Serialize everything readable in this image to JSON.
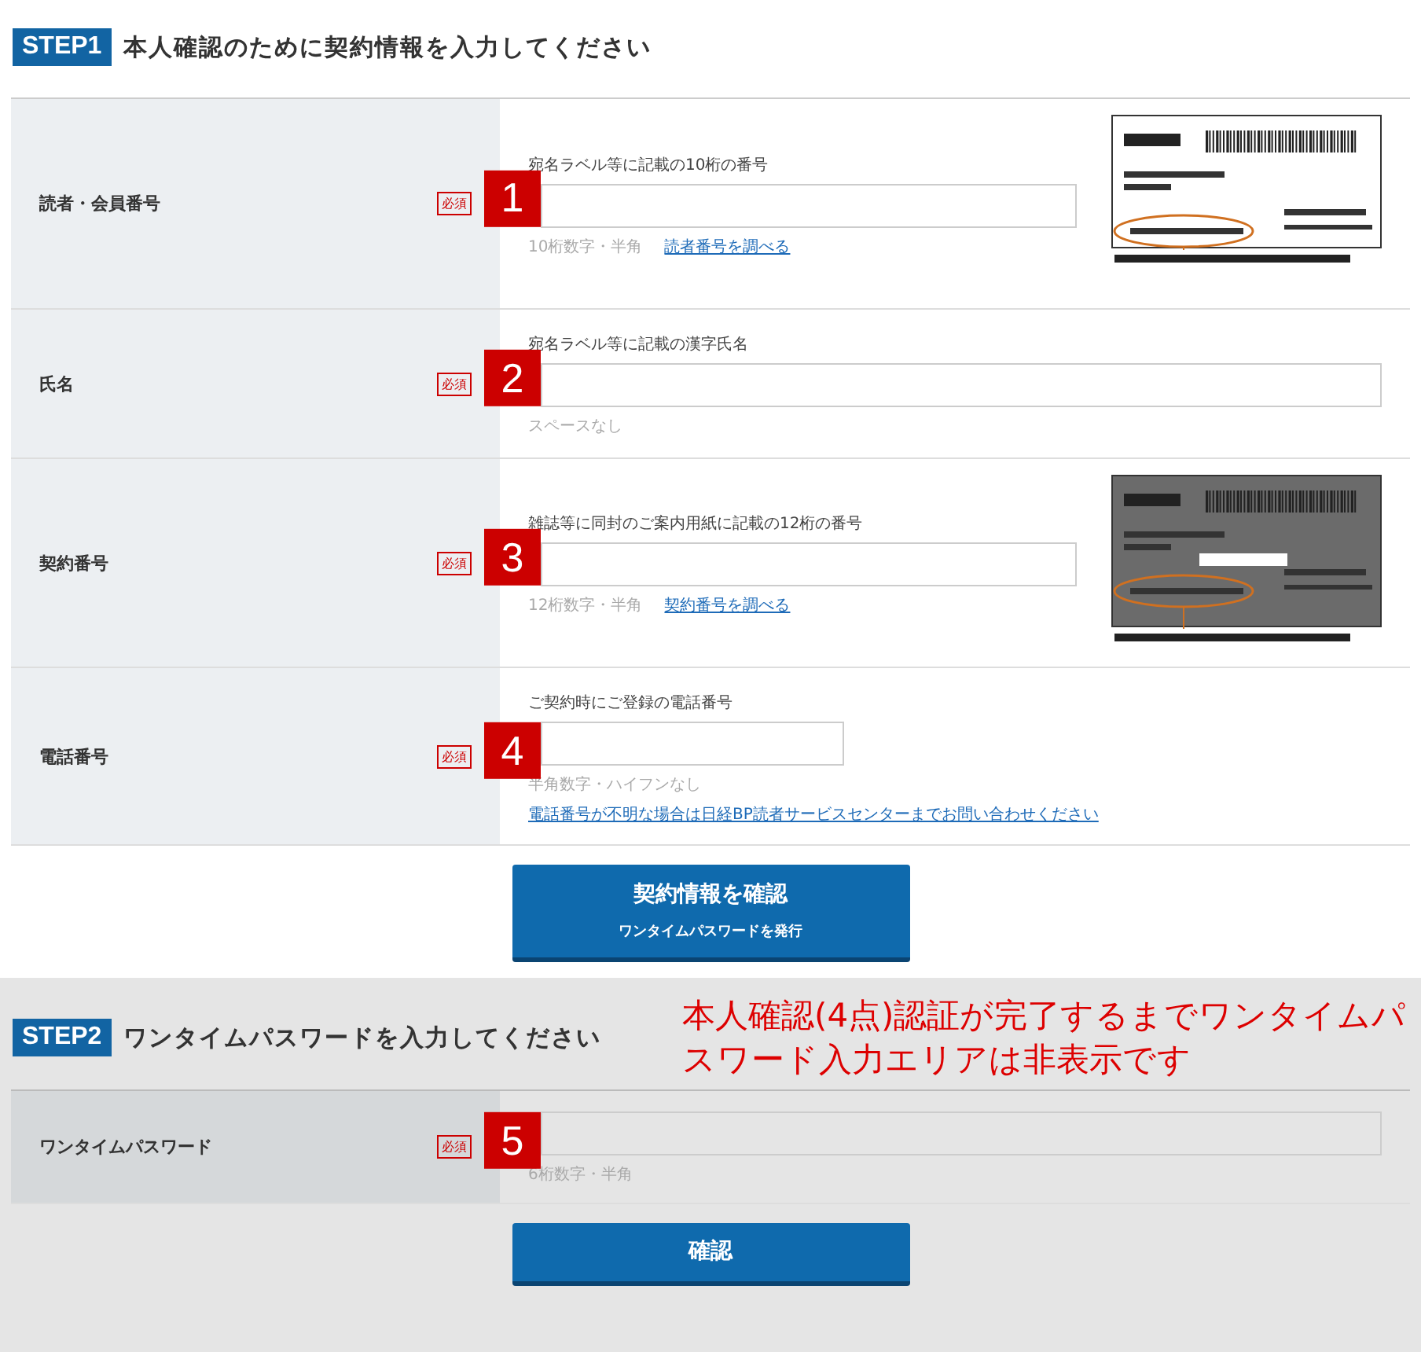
{
  "step1": {
    "badge": "STEP1",
    "title": "本人確認のために契約情報を入力してください"
  },
  "rows": [
    {
      "kind": "with-sample",
      "label": "読者・会員番号",
      "required": "必須",
      "marker": "1",
      "hint": "宛名ラベル等に記載の10桁の番号",
      "note": "10桁数字・半角",
      "link": "読者番号を調べる",
      "sample": {
        "kind": "plain"
      }
    },
    {
      "kind": "plain",
      "label": "氏名",
      "required": "必須",
      "marker": "2",
      "hint": "宛名ラベル等に記載の漢字氏名",
      "note": "スペースなし"
    },
    {
      "kind": "with-sample",
      "label": "契約番号",
      "required": "必須",
      "marker": "3",
      "hint": "雑誌等に同封のご案内用紙に記載の12桁の番号",
      "note": "12桁数字・半角",
      "link": "契約番号を調べる",
      "sample": {
        "kind": "dark"
      }
    },
    {
      "kind": "phone",
      "label": "電話番号",
      "required": "必須",
      "marker": "4",
      "hint": "ご契約時にご登録の電話番号",
      "note": "半角数字・ハイフンなし",
      "link": "電話番号が不明な場合は日経BP読者サービスセンターまでお問い合わせください"
    }
  ],
  "confirm_button": {
    "label": "契約情報を確認",
    "sublabel": "ワンタイムパスワードを発行"
  },
  "step2": {
    "disabled": true,
    "badge": "STEP2",
    "title": "ワンタイムパスワードを入力してください",
    "notice": "本人確認(4点)認証が完了するまでワンタイムパスワード入力エリアは非表示です",
    "row": {
      "label": "ワンタイムパスワード",
      "required": "必須",
      "marker": "5",
      "note": "6桁数字・半角"
    },
    "button": "確認"
  }
}
